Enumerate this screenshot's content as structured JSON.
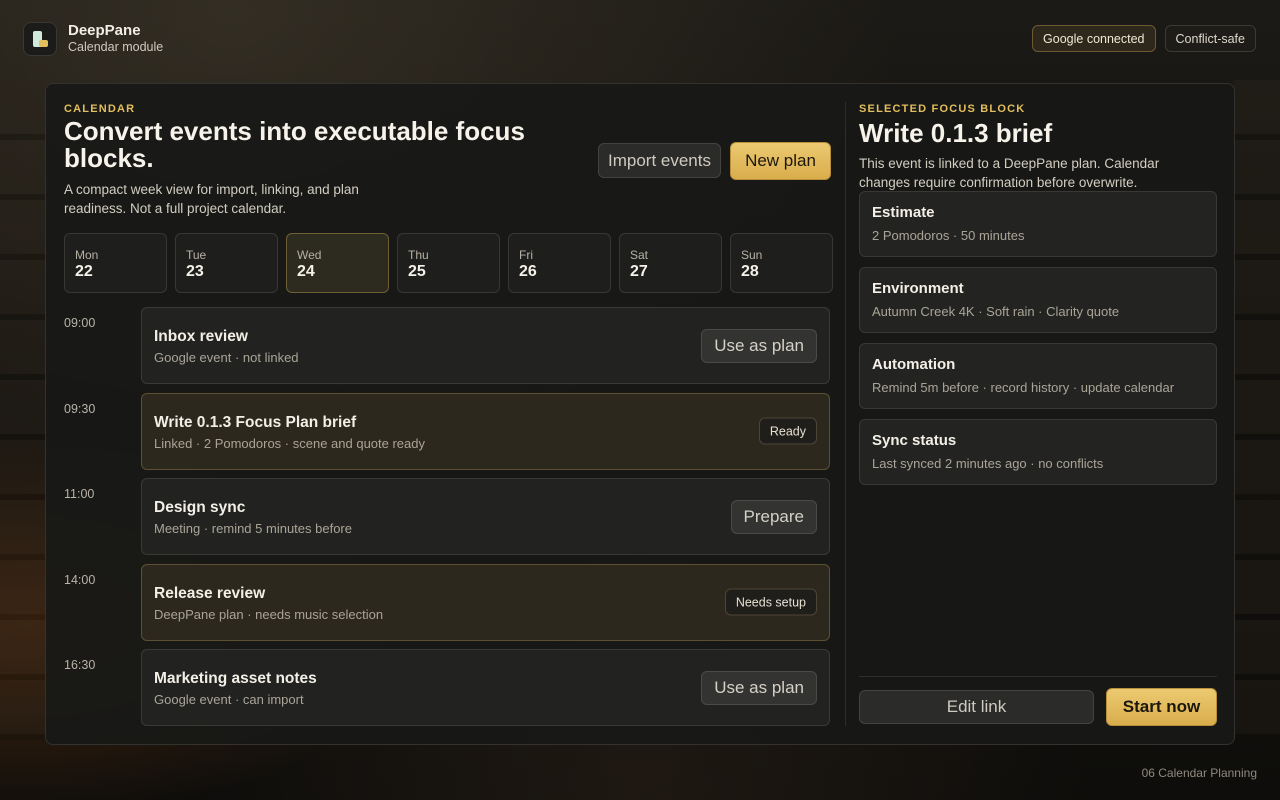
{
  "brand": {
    "name": "DeepPane",
    "subtitle": "Calendar module",
    "icon": "deeppane-logo-icon"
  },
  "top_pills": {
    "google": "Google connected",
    "conflict": "Conflict-safe"
  },
  "colors": {
    "accent_gold": "#e3be5c",
    "button_gold": "#ecc971",
    "panel": "#181917",
    "highlight_card": "#2c281d"
  },
  "calendar": {
    "eyebrow": "CALENDAR",
    "headline": "Convert events into executable focus blocks.",
    "subcopy": "A compact week view for import, linking, and plan readiness. Not a full project calendar.",
    "import_label": "Import events",
    "new_plan_label": "New plan",
    "days": [
      {
        "name": "Mon",
        "num": "22"
      },
      {
        "name": "Tue",
        "num": "23"
      },
      {
        "name": "Wed",
        "num": "24"
      },
      {
        "name": "Thu",
        "num": "25"
      },
      {
        "name": "Fri",
        "num": "26"
      },
      {
        "name": "Sat",
        "num": "27"
      },
      {
        "name": "Sun",
        "num": "28"
      }
    ],
    "selected_day": "Wed",
    "events": [
      {
        "time": "09:00",
        "title": "Inbox review",
        "meta": "Google event · not linked",
        "action": "Use as plan"
      },
      {
        "time": "09:30",
        "title": "Write 0.1.3 Focus Plan brief",
        "meta": "Linked · 2 Pomodoros · scene and quote ready",
        "badge": "Ready"
      },
      {
        "time": "11:00",
        "title": "Design sync",
        "meta": "Meeting · remind 5 minutes before",
        "action": "Prepare"
      },
      {
        "time": "14:00",
        "title": "Release review",
        "meta": "DeepPane plan · needs music selection",
        "badge": "Needs setup"
      },
      {
        "time": "16:30",
        "title": "Marketing asset notes",
        "meta": "Google event · can import",
        "action": "Use as plan"
      }
    ]
  },
  "focus": {
    "eyebrow": "SELECTED FOCUS BLOCK",
    "title": "Write 0.1.3 brief",
    "description": "This event is linked to a DeepPane plan. Calendar changes require confirmation before overwrite.",
    "cards": [
      {
        "title": "Estimate",
        "sub": "2 Pomodoros · 50 minutes"
      },
      {
        "title": "Environment",
        "sub": "Autumn Creek 4K · Soft rain · Clarity quote"
      },
      {
        "title": "Automation",
        "sub": "Remind 5m before · record history · update calendar"
      },
      {
        "title": "Sync status",
        "sub": "Last synced 2 minutes ago · no conflicts"
      }
    ],
    "edit_label": "Edit link",
    "start_label": "Start now"
  },
  "footer": "06 Calendar Planning"
}
